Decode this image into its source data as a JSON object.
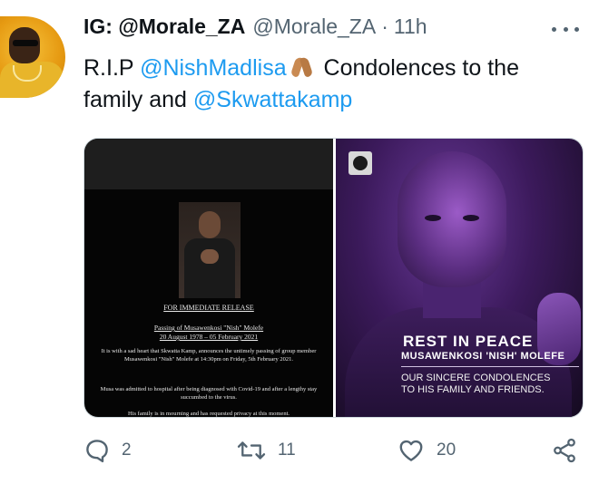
{
  "tweet": {
    "author_name": "IG: @Morale_ZA",
    "author_handle": "@Morale_ZA",
    "separator": "·",
    "time": "11h",
    "text_parts": {
      "prefix": "R.I.P ",
      "mention1": "@NishMadlisa",
      "middle": " Condolences to the family and ",
      "mention2": "@Skwattakamp"
    }
  },
  "media_left": {
    "heading": "FOR IMMEDIATE RELEASE",
    "passing_title": "Passing of Musawenkosi \"Nish\" Molefe",
    "passing_dates": "20 August 1978 – 05 February 2021",
    "paragraph1": "It is with a sad heart that Skwatta Kamp, announces the untimely passing of group member Musawenkosi \"Nish\" Molefe at 14:30pm on Friday, 5th February 2021.",
    "paragraph2": "Musa was admitted to hospital after being diagnosed with Covid-19 and after a lengthy stay succumbed to the virus.",
    "paragraph3": "His family is in mourning and has requested privacy at this moment."
  },
  "media_right": {
    "title": "REST IN PEACE",
    "name": "MUSAWENKOSI 'NISH' MOLEFE",
    "subtitle_line1": "OUR SINCERE CONDOLENCES",
    "subtitle_line2": "TO HIS FAMILY AND FRIENDS."
  },
  "actions": {
    "reply_count": "2",
    "retweet_count": "11",
    "like_count": "20"
  },
  "colors": {
    "accent": "#1d9bf0",
    "secondary_text": "#536471",
    "primary_text": "#0f1419"
  },
  "icons": [
    "more-icon",
    "reply-icon",
    "retweet-icon",
    "like-icon",
    "share-icon",
    "prayer-hands-emoji"
  ]
}
